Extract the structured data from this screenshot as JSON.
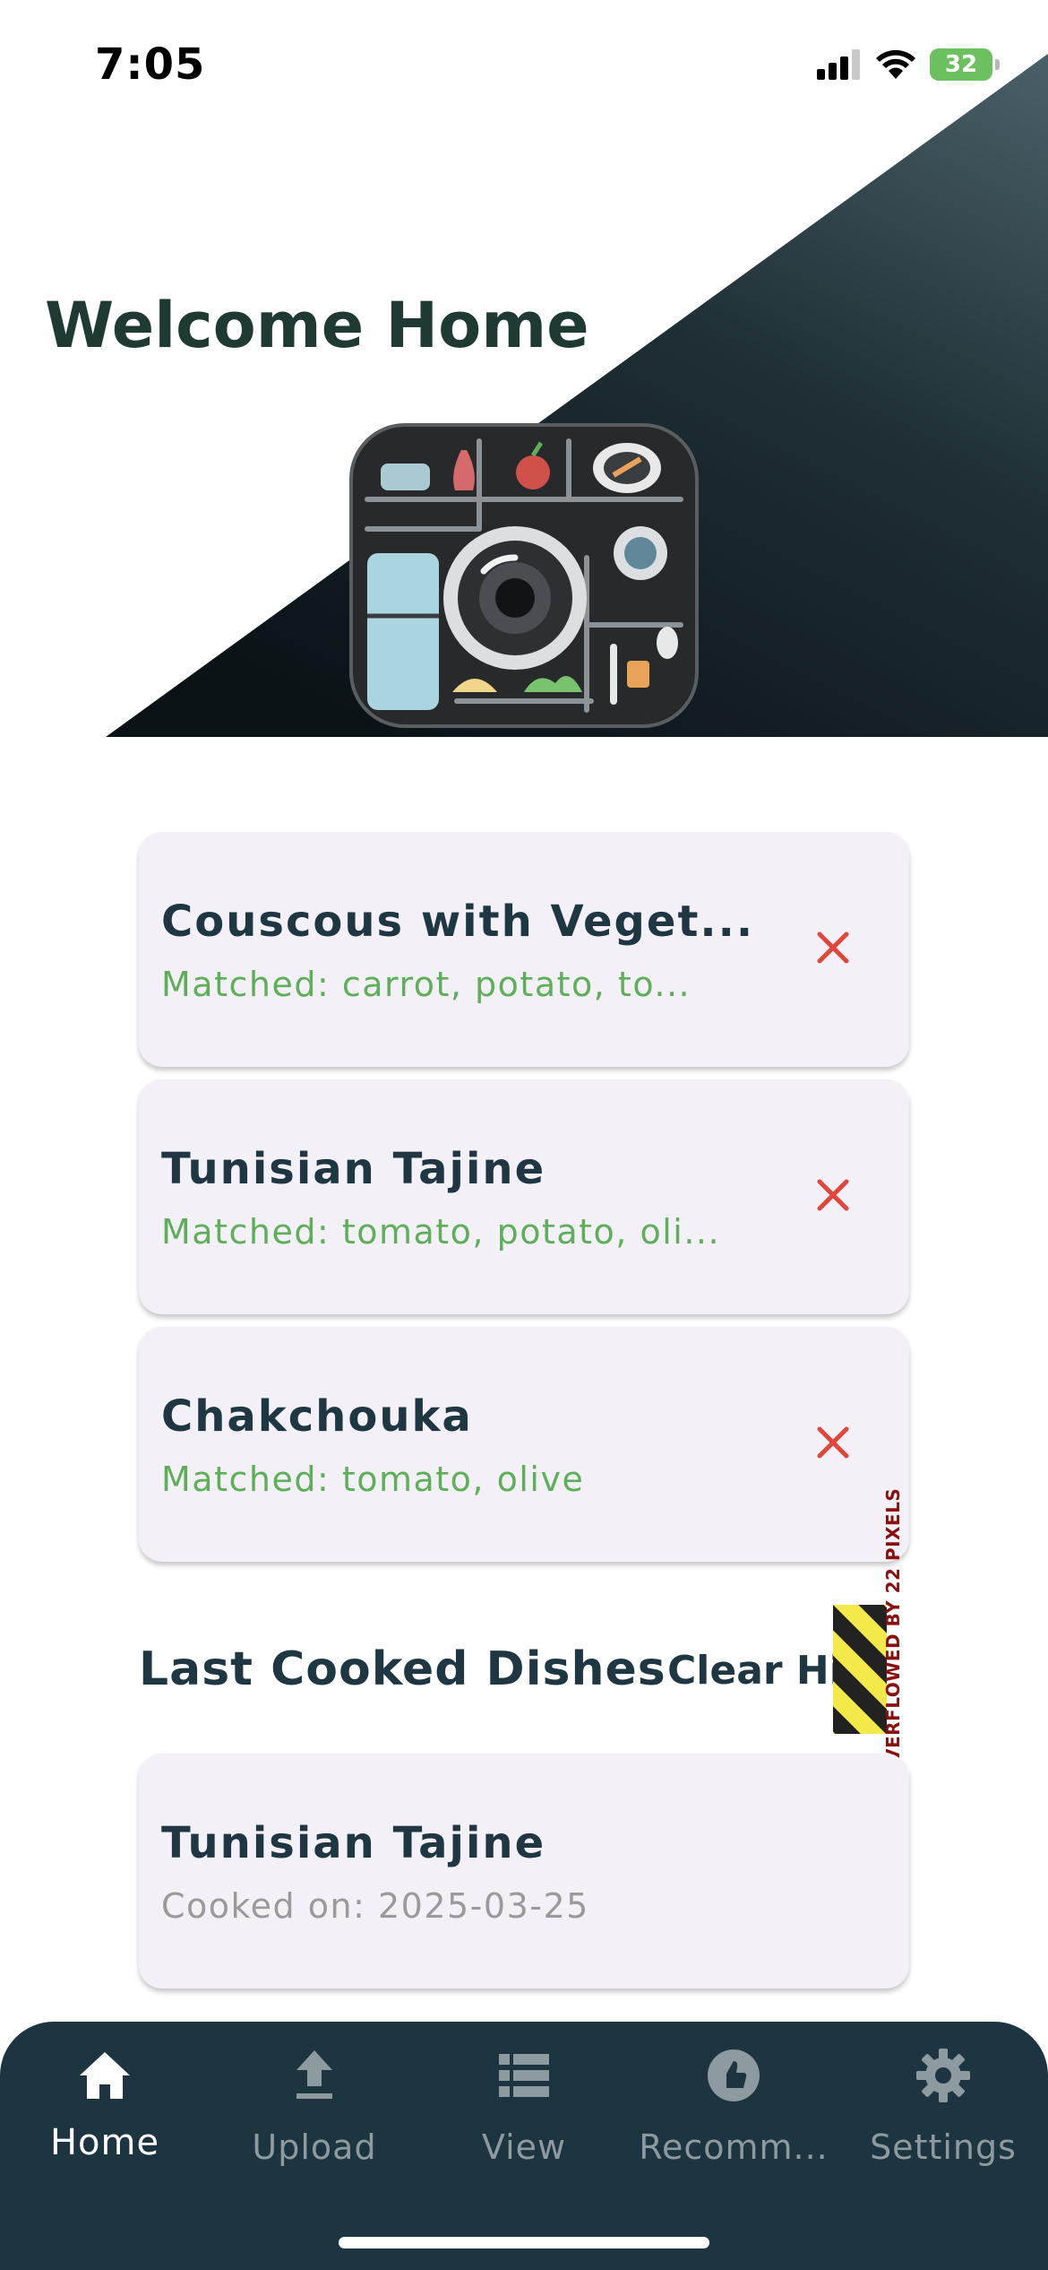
{
  "status_bar": {
    "time": "7:05",
    "battery": "32"
  },
  "header": {
    "title": "Welcome Home",
    "logo_icon": "kitchen-camera-app-icon"
  },
  "recommendations": [
    {
      "title": "Couscous with Veget...",
      "subtitle": "Matched: carrot, potato, to..."
    },
    {
      "title": "Tunisian Tajine",
      "subtitle": "Matched: tomato, potato, oli..."
    },
    {
      "title": "Chakchouka",
      "subtitle": "Matched: tomato, olive"
    }
  ],
  "history": {
    "title": "Last Cooked Dishes",
    "clear_label": "Clear Hist",
    "overflow_warning": "VERFLOWED BY 22 PIXELS",
    "items": [
      {
        "title": "Tunisian Tajine",
        "subtitle": "Cooked on: 2025-03-25"
      }
    ]
  },
  "bottom_nav": {
    "items": [
      {
        "label": "Home",
        "icon": "home-icon",
        "active": true
      },
      {
        "label": "Upload",
        "icon": "upload-icon",
        "active": false
      },
      {
        "label": "View",
        "icon": "list-view-icon",
        "active": false
      },
      {
        "label": "Recomm...",
        "icon": "recommend-icon",
        "active": false
      },
      {
        "label": "Settings",
        "icon": "gear-icon",
        "active": false
      }
    ]
  },
  "colors": {
    "primary": "#1d3540",
    "heading": "#1f3a32",
    "match_text": "#5fae5a",
    "remove_icon": "#e0463a",
    "card_bg": "#f3f0f7"
  }
}
